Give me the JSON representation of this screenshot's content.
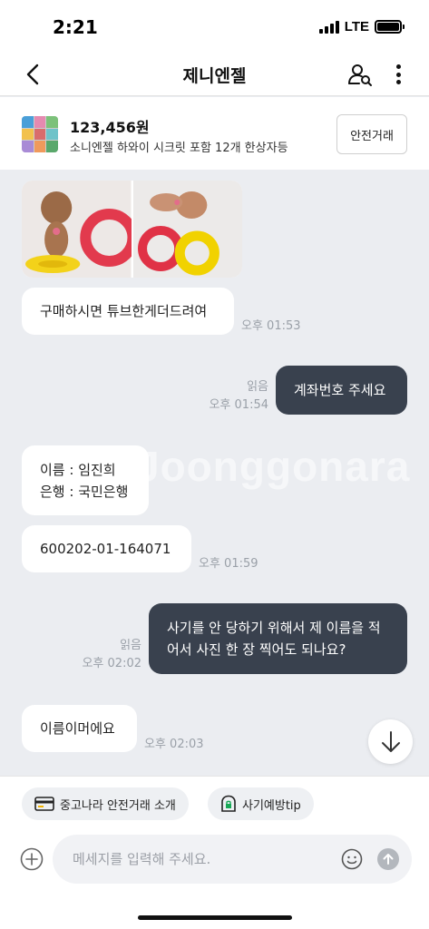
{
  "status_bar": {
    "time": "2:21",
    "network": "LTE"
  },
  "header": {
    "title": "제니엔젤",
    "back_icon": "chevron-left-icon",
    "profile_icon": "user-search-icon",
    "more_icon": "more-vertical-icon"
  },
  "product": {
    "price": "123,456원",
    "name": "소니엔젤 하와이 시크릿 포함 12개 한상자등",
    "safe_trade_label": "안전거래"
  },
  "messages": [
    {
      "id": "m1",
      "side": "in",
      "text": "구매하시면 튜브한게더드려여",
      "time": "오후 01:53"
    },
    {
      "id": "m2",
      "side": "out",
      "text": "계좌번호 주세요",
      "read": "읽음",
      "time": "오후 01:54"
    },
    {
      "id": "m3",
      "side": "in",
      "line1": "이름 : 임진희",
      "line2": "은행 : 국민은행"
    },
    {
      "id": "m4",
      "side": "in",
      "text": "600202-01-164071",
      "time": "오후 01:59"
    },
    {
      "id": "m5",
      "side": "out",
      "line1": "사기를 안 당하기 위해서 제 이름을 적",
      "line2": "어서 사진 한 장 찍어도 되나요?",
      "read": "읽음",
      "time": "오후 02:02"
    },
    {
      "id": "m6",
      "side": "in",
      "text": "이름이머에요",
      "time": "오후 02:03"
    }
  ],
  "watermark": "Joonggonara",
  "quick_actions": [
    {
      "label": "중고나라 안전거래 소개",
      "icon": "card-icon"
    },
    {
      "label": "사기예방tip",
      "icon": "shield-lock-icon"
    }
  ],
  "composer": {
    "placeholder": "메세지를 입력해 주세요.",
    "value": ""
  },
  "colors": {
    "chat_background": "#ebedf1",
    "outgoing_bubble": "#39414e",
    "incoming_bubble": "#ffffff",
    "meta_text": "#9aa0a8"
  }
}
